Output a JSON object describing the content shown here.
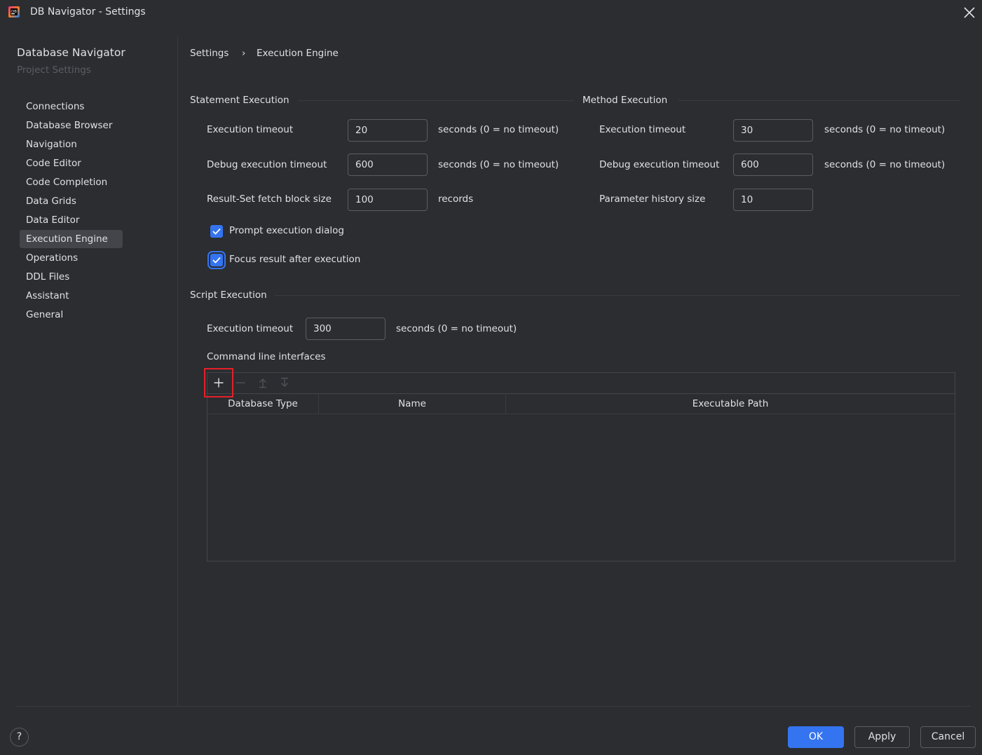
{
  "window": {
    "title": "DB Navigator - Settings"
  },
  "sidebar": {
    "title": "Database Navigator",
    "subtitle": "Project Settings",
    "items": [
      {
        "label": "Connections"
      },
      {
        "label": "Database Browser"
      },
      {
        "label": "Navigation"
      },
      {
        "label": "Code Editor"
      },
      {
        "label": "Code Completion"
      },
      {
        "label": "Data Grids"
      },
      {
        "label": "Data Editor"
      },
      {
        "label": "Execution Engine",
        "selected": true
      },
      {
        "label": "Operations"
      },
      {
        "label": "DDL Files"
      },
      {
        "label": "Assistant"
      },
      {
        "label": "General"
      }
    ]
  },
  "breadcrumb": {
    "root": "Settings",
    "separator": "›",
    "current": "Execution Engine"
  },
  "statement": {
    "title": "Statement Execution",
    "exec_timeout": {
      "label": "Execution timeout",
      "value": "20",
      "suffix": "seconds (0 = no timeout)"
    },
    "debug_timeout": {
      "label": "Debug execution timeout",
      "value": "600",
      "suffix": "seconds (0 = no timeout)"
    },
    "fetch_size": {
      "label": "Result-Set fetch block size",
      "value": "100",
      "suffix": "records"
    },
    "prompt_dialog": {
      "label": "Prompt execution dialog",
      "checked": true
    },
    "focus_result": {
      "label": "Focus result after execution",
      "checked": true
    }
  },
  "method": {
    "title": "Method Execution",
    "exec_timeout": {
      "label": "Execution timeout",
      "value": "30",
      "suffix": "seconds (0 = no timeout)"
    },
    "debug_timeout": {
      "label": "Debug execution timeout",
      "value": "600",
      "suffix": "seconds (0 = no timeout)"
    },
    "history_size": {
      "label": "Parameter history size",
      "value": "10"
    }
  },
  "script": {
    "title": "Script Execution",
    "exec_timeout": {
      "label": "Execution timeout",
      "value": "300",
      "suffix": "seconds (0 = no timeout)"
    },
    "cli_label": "Command line interfaces",
    "columns": [
      "Database Type",
      "Name",
      "Executable Path"
    ],
    "rows": []
  },
  "footer": {
    "help": "?",
    "ok": "OK",
    "apply": "Apply",
    "cancel": "Cancel"
  },
  "colors": {
    "accent": "#3574f0",
    "highlight": "#e5202a",
    "background": "#2b2d30"
  },
  "icons": [
    "app-icon",
    "close-icon",
    "add-icon",
    "remove-icon",
    "move-up-icon",
    "move-down-icon",
    "check-icon",
    "help-icon"
  ]
}
